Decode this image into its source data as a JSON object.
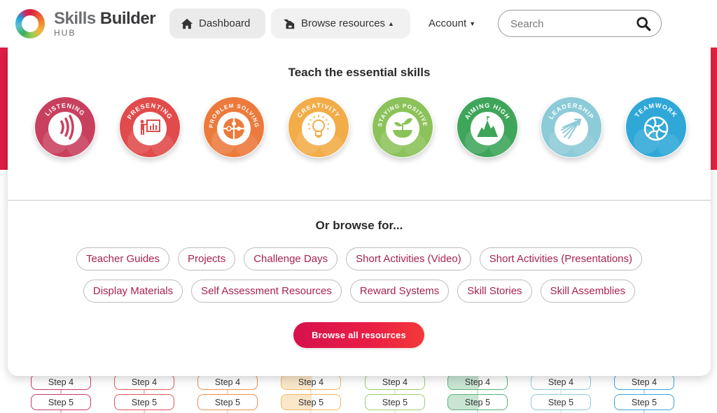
{
  "header": {
    "logo": {
      "name_part1": "Skills",
      "name_part2": "Builder",
      "sub": "HUB"
    },
    "nav": {
      "dashboard": {
        "label": "Dashboard",
        "icon": "home-icon"
      },
      "browse": {
        "label": "Browse resources",
        "icon": "folders-icon",
        "caret": "▲"
      },
      "account": {
        "label": "Account",
        "caret": "▼"
      }
    },
    "search": {
      "placeholder": "Search",
      "value": "",
      "icon": "search-icon"
    }
  },
  "panel": {
    "skills_title": "Teach the essential skills",
    "skills": [
      {
        "name": "LISTENING",
        "icon": "sound-waves-icon",
        "color": "#c9405f"
      },
      {
        "name": "PRESENTING",
        "icon": "presenter-icon",
        "color": "#e14b4b"
      },
      {
        "name": "PROBLEM SOLVING",
        "icon": "puzzle-icon",
        "color": "#ec7a3c"
      },
      {
        "name": "CREATIVITY",
        "icon": "lightbulb-icon",
        "color": "#f2ac48"
      },
      {
        "name": "STAYING POSITIVE",
        "icon": "seedling-icon",
        "color": "#8cc25a"
      },
      {
        "name": "AIMING HIGH",
        "icon": "mountain-icon",
        "color": "#3fa55b"
      },
      {
        "name": "LEADERSHIP",
        "icon": "arrow-burst-icon",
        "color": "#8ccbd8"
      },
      {
        "name": "TEAMWORK",
        "icon": "wheel-icon",
        "color": "#2fa8d8"
      }
    ],
    "browse_title": "Or browse for...",
    "chips_row1": [
      "Teacher Guides",
      "Projects",
      "Challenge Days",
      "Short Activities (Video)",
      "Short Activities (Presentations)"
    ],
    "chips_row2": [
      "Display Materials",
      "Self Assessment Resources",
      "Reward Systems",
      "Skill Stories",
      "Skill Assemblies"
    ],
    "browse_all_label": "Browse all resources"
  },
  "background": {
    "step_columns": [
      {
        "color": "#c93a6b",
        "fill": "none",
        "steps": [
          "Step 4",
          "Step 5"
        ]
      },
      {
        "color": "#e0585a",
        "fill": "none",
        "steps": [
          "Step 4",
          "Step 5"
        ]
      },
      {
        "color": "#ec8e55",
        "fill": "none",
        "steps": [
          "Step 4",
          "Step 5"
        ]
      },
      {
        "color": "#f2b860",
        "fill": "partial",
        "steps": [
          "Step 4",
          "Step 5"
        ]
      },
      {
        "color": "#9fcc78",
        "fill": "none",
        "steps": [
          "Step 4",
          "Step 5"
        ]
      },
      {
        "color": "#5bb177",
        "fill": "partial",
        "steps": [
          "Step 4",
          "Step 5"
        ]
      },
      {
        "color": "#8fcad6",
        "fill": "none",
        "steps": [
          "Step 4",
          "Step 5"
        ]
      },
      {
        "color": "#3aa6d6",
        "fill": "none",
        "steps": [
          "Step 4",
          "Step 5"
        ]
      }
    ]
  }
}
